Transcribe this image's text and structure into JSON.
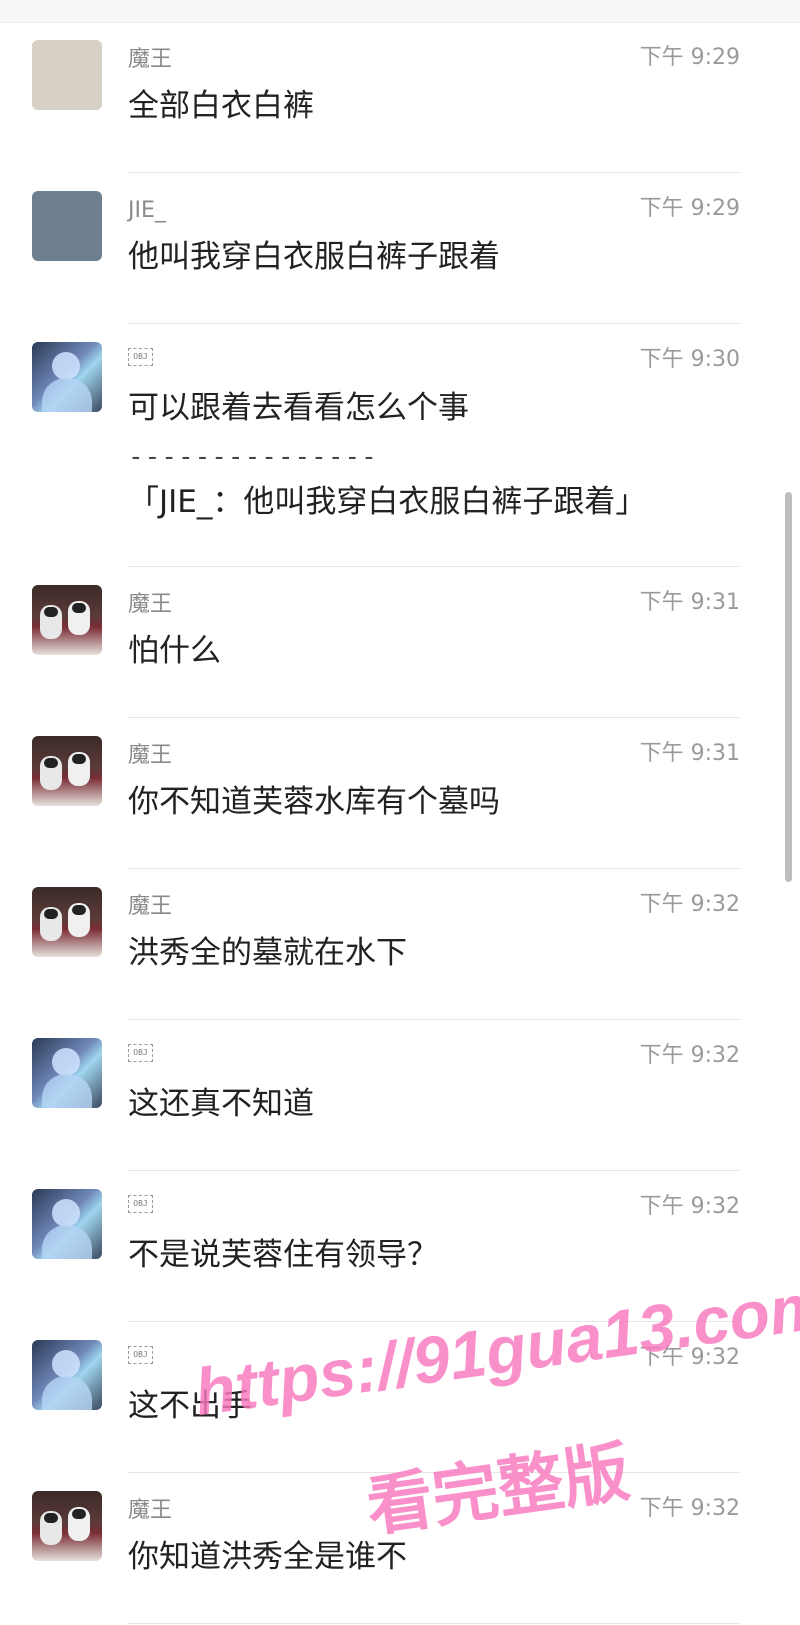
{
  "messages": [
    {
      "avatar": "beige-square-avatar",
      "name": "魔王",
      "time": "下午 9:29",
      "text": "全部白衣白裤"
    },
    {
      "avatar": "slate-square-avatar",
      "name": "JIE_",
      "time": "下午 9:29",
      "text": "他叫我穿白衣服白裤子跟着"
    },
    {
      "avatar": "person-avatar",
      "name": "OBJ",
      "time": "下午 9:30",
      "text": "可以跟着去看看怎么个事",
      "dash": "---------------",
      "quote": "「JIE_：他叫我穿白衣服白裤子跟着」"
    },
    {
      "avatar": "dogs-avatar",
      "name": "魔王",
      "time": "下午 9:31",
      "text": "怕什么"
    },
    {
      "avatar": "dogs-avatar",
      "name": "魔王",
      "time": "下午 9:31",
      "text": "你不知道芙蓉水库有个墓吗"
    },
    {
      "avatar": "dogs-avatar",
      "name": "魔王",
      "time": "下午 9:32",
      "text": "洪秀全的墓就在水下"
    },
    {
      "avatar": "person-avatar",
      "name": "OBJ",
      "time": "下午 9:32",
      "text": "这还真不知道"
    },
    {
      "avatar": "person-avatar",
      "name": "OBJ",
      "time": "下午 9:32",
      "text": "不是说芙蓉住有领导？"
    },
    {
      "avatar": "person-avatar",
      "name": "OBJ",
      "time": "下午 9:32",
      "text": "这不出手"
    },
    {
      "avatar": "dogs-avatar",
      "name": "魔王",
      "time": "下午 9:32",
      "text": "你知道洪秀全是谁不"
    }
  ],
  "watermark": {
    "url": "https://91gua13.com",
    "caption": "看完整版"
  }
}
